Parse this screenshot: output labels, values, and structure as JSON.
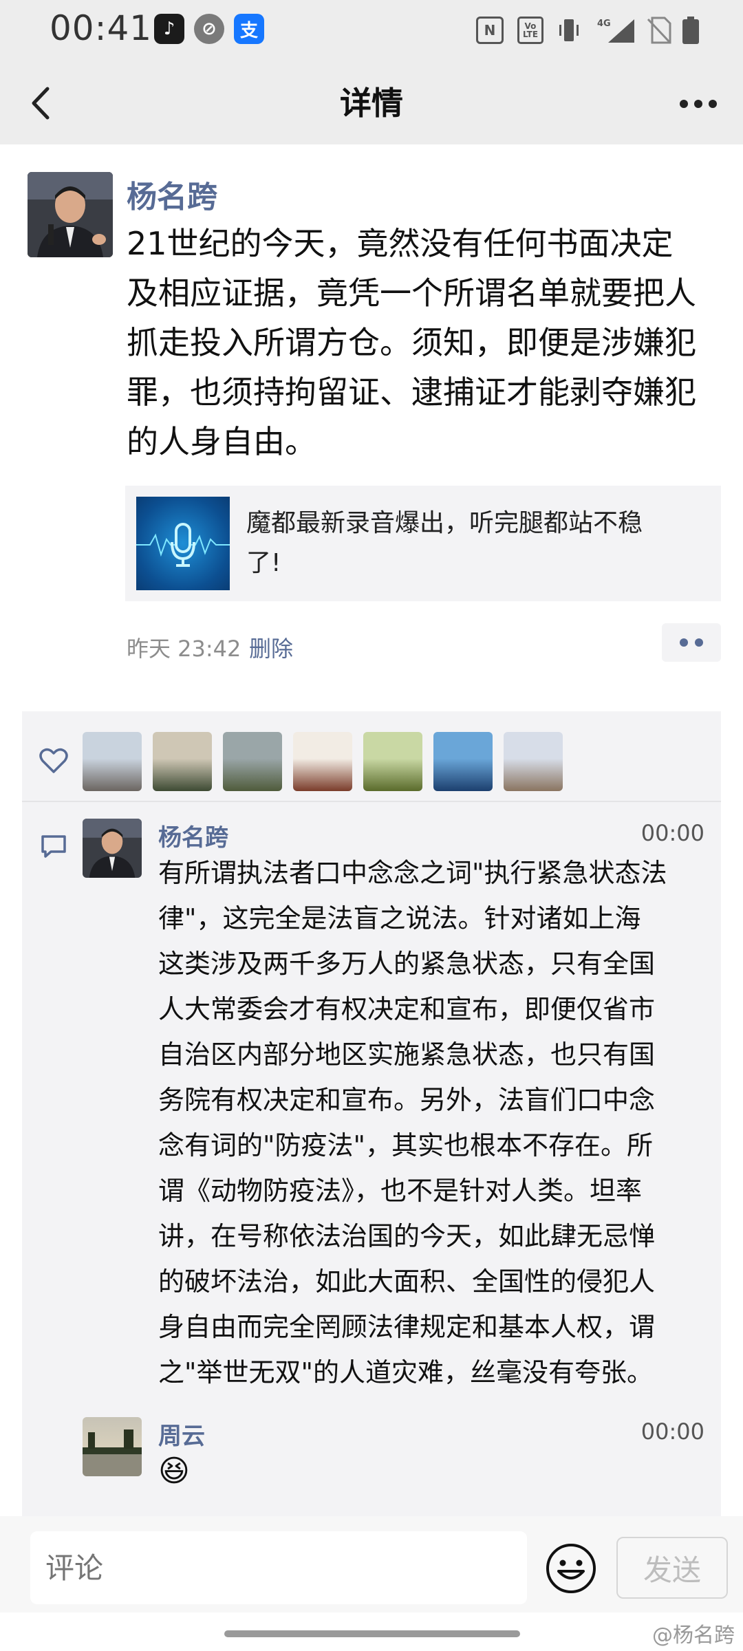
{
  "status_bar": {
    "time": "00:41",
    "network": "4G",
    "icons": [
      "tiktok-icon",
      "app-icon",
      "alipay-icon",
      "nfc-icon",
      "volte-icon",
      "vibrate-icon",
      "signal-4g-icon",
      "no-sim-icon",
      "battery-icon"
    ]
  },
  "nav": {
    "title": "详情",
    "back_icon": "chevron-left-icon",
    "more_icon": "more-icon"
  },
  "post": {
    "author": "杨名跨",
    "lines": [
      "21世纪的今天，竟然没有任何书面决定",
      "及相应证据，竟凭一个所谓名单就要把人",
      "抓走投入所谓方仓。须知，即便是涉嫌犯",
      "罪，也须持拘留证、逮捕证才能剥夺嫌犯",
      "的人身自由。"
    ],
    "share": {
      "title_lines": [
        "魔都最新录音爆出，听完腿都站不稳",
        "了!"
      ],
      "thumb_icon": "microphone-icon"
    },
    "time": "昨天 23:42",
    "delete_label": "删除"
  },
  "interactions": {
    "like_icon": "heart-icon",
    "comment_icon": "comment-icon",
    "likers": [
      {
        "colors": [
          "#c9d3de",
          "#6b6560"
        ]
      },
      {
        "colors": [
          "#cfc7b5",
          "#3d4a33"
        ]
      },
      {
        "colors": [
          "#9aa6a8",
          "#4f5b3b"
        ]
      },
      {
        "colors": [
          "#f2ece4",
          "#7a3c2a"
        ]
      },
      {
        "colors": [
          "#c9d8a4",
          "#5a6b2b"
        ]
      },
      {
        "colors": [
          "#6aa6d8",
          "#1c3f6e"
        ]
      },
      {
        "colors": [
          "#d7dde8",
          "#8a7460"
        ]
      }
    ],
    "comments": [
      {
        "author": "杨名跨",
        "time": "00:00",
        "lines": [
          "有所谓执法者口中念念之词\"执行紧急状态法",
          "律\"，这完全是法盲之说法。针对诸如上海",
          "这类涉及两千多万人的紧急状态，只有全国",
          "人大常委会才有权决定和宣布，即便仅省市",
          "自治区内部分地区实施紧急状态，也只有国",
          "务院有权决定和宣布。另外，法盲们口中念",
          "念有词的\"防疫法\"，其实也根本不存在。所",
          "谓《动物防疫法》，也不是针对人类。坦率",
          "讲，在号称依法治国的今天，如此肆无忌惮",
          "的破坏法治，如此大面积、全国性的侵犯人",
          "身自由而完全罔顾法律规定和基本人权，谓",
          "之\"举世无双\"的人道灾难，丝毫没有夸张。"
        ]
      },
      {
        "author": "周云",
        "time": "00:00",
        "emoji": "😆"
      }
    ]
  },
  "input_bar": {
    "placeholder": "评论",
    "send_label": "发送",
    "emoji_icon": "smiley-icon"
  },
  "watermark": "@杨名跨"
}
